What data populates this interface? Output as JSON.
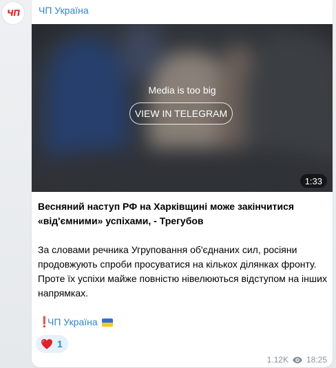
{
  "channel": {
    "name": "ЧП Україна",
    "avatar_text": "ЧП"
  },
  "media": {
    "notice": "Media is too big",
    "button_label": "VIEW IN TELEGRAM",
    "duration": "1:33"
  },
  "post": {
    "headline": "Весняний наступ РФ на Харківщині може закінчитися «від'ємними» успіхами, - Трегубов",
    "body": "За словами речника Угруповання об'єднаних сил, росіяни продовжують спроби просуватися на кількох ділянках фронту. Проте їх успіхи майже повністю нівелюються відступом на інших напрямках.",
    "signature_mark": "❗",
    "signature_link": "ЧП Україна"
  },
  "reactions": [
    {
      "icon": "red-heart-icon",
      "count": "1"
    }
  ],
  "meta": {
    "views": "1.12K",
    "time": "18:25"
  },
  "colors": {
    "link": "#2f87c7",
    "avatar_red": "#e3262b",
    "reaction_bg": "#e7f1fa"
  }
}
